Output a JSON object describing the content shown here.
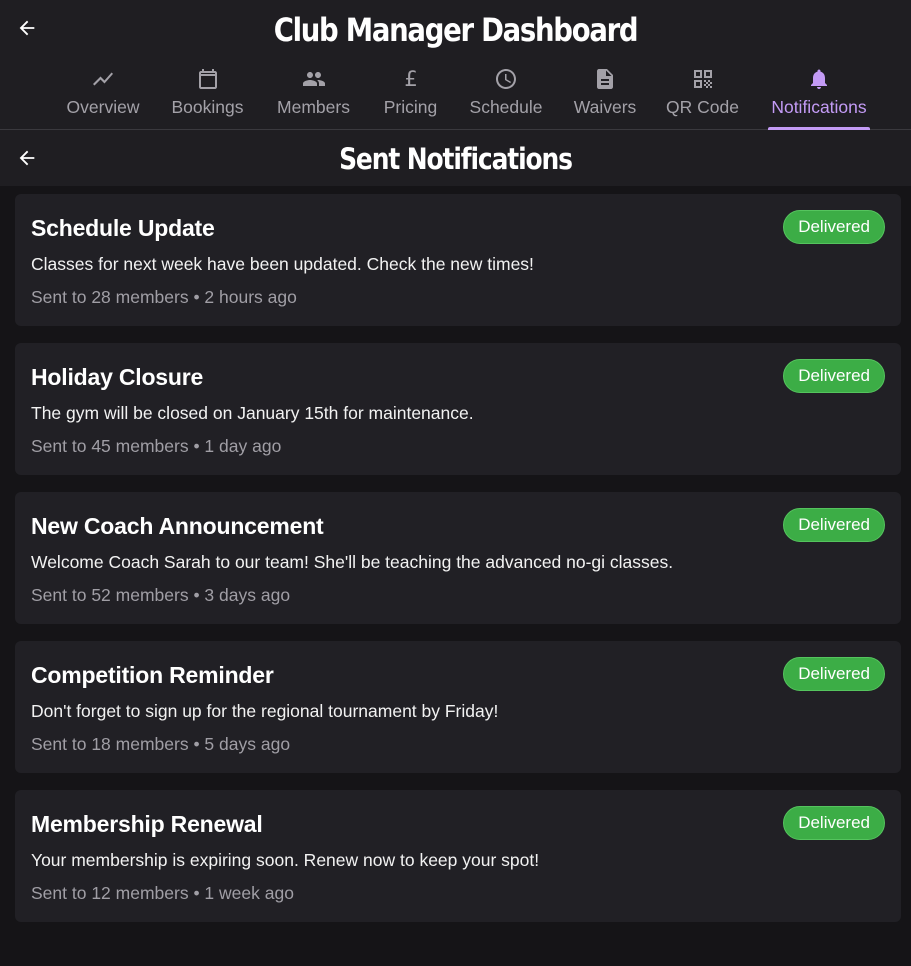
{
  "header": {
    "title": "Club Manager Dashboard"
  },
  "tabs": [
    {
      "label": "Overview",
      "icon": "trending-up-icon"
    },
    {
      "label": "Bookings",
      "icon": "calendar-icon"
    },
    {
      "label": "Members",
      "icon": "people-icon"
    },
    {
      "label": "Pricing",
      "icon": "pound-icon"
    },
    {
      "label": "Schedule",
      "icon": "clock-icon"
    },
    {
      "label": "Waivers",
      "icon": "document-icon"
    },
    {
      "label": "QR Code",
      "icon": "qr-code-icon"
    },
    {
      "label": "Notifications",
      "icon": "bell-icon",
      "active": true
    }
  ],
  "subheader": {
    "title": "Sent Notifications"
  },
  "notifications": [
    {
      "title": "Schedule Update",
      "message": "Classes for next week have been updated. Check the new times!",
      "meta": "Sent to 28 members • 2 hours ago",
      "status": "Delivered"
    },
    {
      "title": "Holiday Closure",
      "message": "The gym will be closed on January 15th for maintenance.",
      "meta": "Sent to 45 members • 1 day ago",
      "status": "Delivered"
    },
    {
      "title": "New Coach Announcement",
      "message": "Welcome Coach Sarah to our team! She'll be teaching the advanced no-gi classes.",
      "meta": "Sent to 52 members • 3 days ago",
      "status": "Delivered"
    },
    {
      "title": "Competition Reminder",
      "message": "Don't forget to sign up for the regional tournament by Friday!",
      "meta": "Sent to 18 members • 5 days ago",
      "status": "Delivered"
    },
    {
      "title": "Membership Renewal",
      "message": "Your membership is expiring soon. Renew now to keep your spot!",
      "meta": "Sent to 12 members • 1 week ago",
      "status": "Delivered"
    }
  ],
  "colors": {
    "accent": "#c39bf5",
    "delivered": "#3cad46",
    "background": "#151417",
    "surface": "#212025"
  }
}
